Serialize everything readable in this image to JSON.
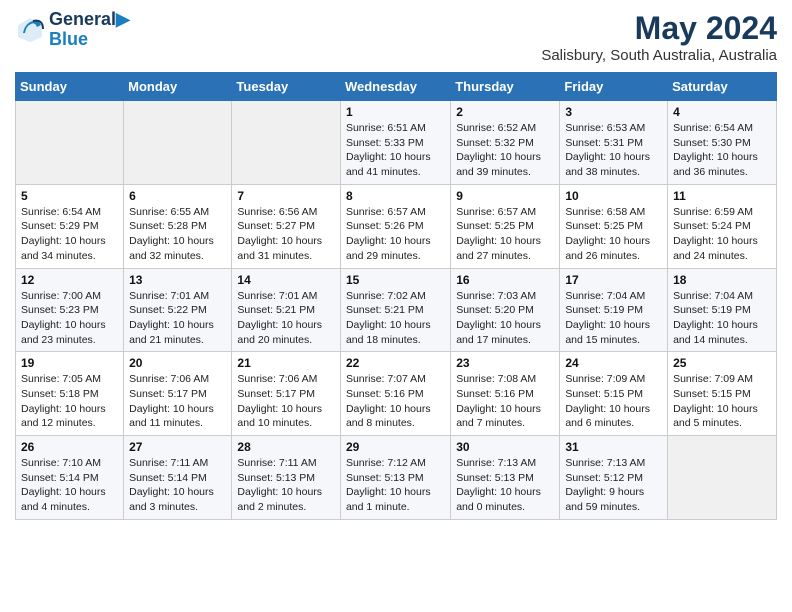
{
  "logo": {
    "line1": "General",
    "line2": "Blue"
  },
  "title": "May 2024",
  "subtitle": "Salisbury, South Australia, Australia",
  "days_of_week": [
    "Sunday",
    "Monday",
    "Tuesday",
    "Wednesday",
    "Thursday",
    "Friday",
    "Saturday"
  ],
  "weeks": [
    [
      {
        "day": "",
        "info": ""
      },
      {
        "day": "",
        "info": ""
      },
      {
        "day": "",
        "info": ""
      },
      {
        "day": "1",
        "info": "Sunrise: 6:51 AM\nSunset: 5:33 PM\nDaylight: 10 hours\nand 41 minutes."
      },
      {
        "day": "2",
        "info": "Sunrise: 6:52 AM\nSunset: 5:32 PM\nDaylight: 10 hours\nand 39 minutes."
      },
      {
        "day": "3",
        "info": "Sunrise: 6:53 AM\nSunset: 5:31 PM\nDaylight: 10 hours\nand 38 minutes."
      },
      {
        "day": "4",
        "info": "Sunrise: 6:54 AM\nSunset: 5:30 PM\nDaylight: 10 hours\nand 36 minutes."
      }
    ],
    [
      {
        "day": "5",
        "info": "Sunrise: 6:54 AM\nSunset: 5:29 PM\nDaylight: 10 hours\nand 34 minutes."
      },
      {
        "day": "6",
        "info": "Sunrise: 6:55 AM\nSunset: 5:28 PM\nDaylight: 10 hours\nand 32 minutes."
      },
      {
        "day": "7",
        "info": "Sunrise: 6:56 AM\nSunset: 5:27 PM\nDaylight: 10 hours\nand 31 minutes."
      },
      {
        "day": "8",
        "info": "Sunrise: 6:57 AM\nSunset: 5:26 PM\nDaylight: 10 hours\nand 29 minutes."
      },
      {
        "day": "9",
        "info": "Sunrise: 6:57 AM\nSunset: 5:25 PM\nDaylight: 10 hours\nand 27 minutes."
      },
      {
        "day": "10",
        "info": "Sunrise: 6:58 AM\nSunset: 5:25 PM\nDaylight: 10 hours\nand 26 minutes."
      },
      {
        "day": "11",
        "info": "Sunrise: 6:59 AM\nSunset: 5:24 PM\nDaylight: 10 hours\nand 24 minutes."
      }
    ],
    [
      {
        "day": "12",
        "info": "Sunrise: 7:00 AM\nSunset: 5:23 PM\nDaylight: 10 hours\nand 23 minutes."
      },
      {
        "day": "13",
        "info": "Sunrise: 7:01 AM\nSunset: 5:22 PM\nDaylight: 10 hours\nand 21 minutes."
      },
      {
        "day": "14",
        "info": "Sunrise: 7:01 AM\nSunset: 5:21 PM\nDaylight: 10 hours\nand 20 minutes."
      },
      {
        "day": "15",
        "info": "Sunrise: 7:02 AM\nSunset: 5:21 PM\nDaylight: 10 hours\nand 18 minutes."
      },
      {
        "day": "16",
        "info": "Sunrise: 7:03 AM\nSunset: 5:20 PM\nDaylight: 10 hours\nand 17 minutes."
      },
      {
        "day": "17",
        "info": "Sunrise: 7:04 AM\nSunset: 5:19 PM\nDaylight: 10 hours\nand 15 minutes."
      },
      {
        "day": "18",
        "info": "Sunrise: 7:04 AM\nSunset: 5:19 PM\nDaylight: 10 hours\nand 14 minutes."
      }
    ],
    [
      {
        "day": "19",
        "info": "Sunrise: 7:05 AM\nSunset: 5:18 PM\nDaylight: 10 hours\nand 12 minutes."
      },
      {
        "day": "20",
        "info": "Sunrise: 7:06 AM\nSunset: 5:17 PM\nDaylight: 10 hours\nand 11 minutes."
      },
      {
        "day": "21",
        "info": "Sunrise: 7:06 AM\nSunset: 5:17 PM\nDaylight: 10 hours\nand 10 minutes."
      },
      {
        "day": "22",
        "info": "Sunrise: 7:07 AM\nSunset: 5:16 PM\nDaylight: 10 hours\nand 8 minutes."
      },
      {
        "day": "23",
        "info": "Sunrise: 7:08 AM\nSunset: 5:16 PM\nDaylight: 10 hours\nand 7 minutes."
      },
      {
        "day": "24",
        "info": "Sunrise: 7:09 AM\nSunset: 5:15 PM\nDaylight: 10 hours\nand 6 minutes."
      },
      {
        "day": "25",
        "info": "Sunrise: 7:09 AM\nSunset: 5:15 PM\nDaylight: 10 hours\nand 5 minutes."
      }
    ],
    [
      {
        "day": "26",
        "info": "Sunrise: 7:10 AM\nSunset: 5:14 PM\nDaylight: 10 hours\nand 4 minutes."
      },
      {
        "day": "27",
        "info": "Sunrise: 7:11 AM\nSunset: 5:14 PM\nDaylight: 10 hours\nand 3 minutes."
      },
      {
        "day": "28",
        "info": "Sunrise: 7:11 AM\nSunset: 5:13 PM\nDaylight: 10 hours\nand 2 minutes."
      },
      {
        "day": "29",
        "info": "Sunrise: 7:12 AM\nSunset: 5:13 PM\nDaylight: 10 hours\nand 1 minute."
      },
      {
        "day": "30",
        "info": "Sunrise: 7:13 AM\nSunset: 5:13 PM\nDaylight: 10 hours\nand 0 minutes."
      },
      {
        "day": "31",
        "info": "Sunrise: 7:13 AM\nSunset: 5:12 PM\nDaylight: 9 hours\nand 59 minutes."
      },
      {
        "day": "",
        "info": ""
      }
    ]
  ]
}
